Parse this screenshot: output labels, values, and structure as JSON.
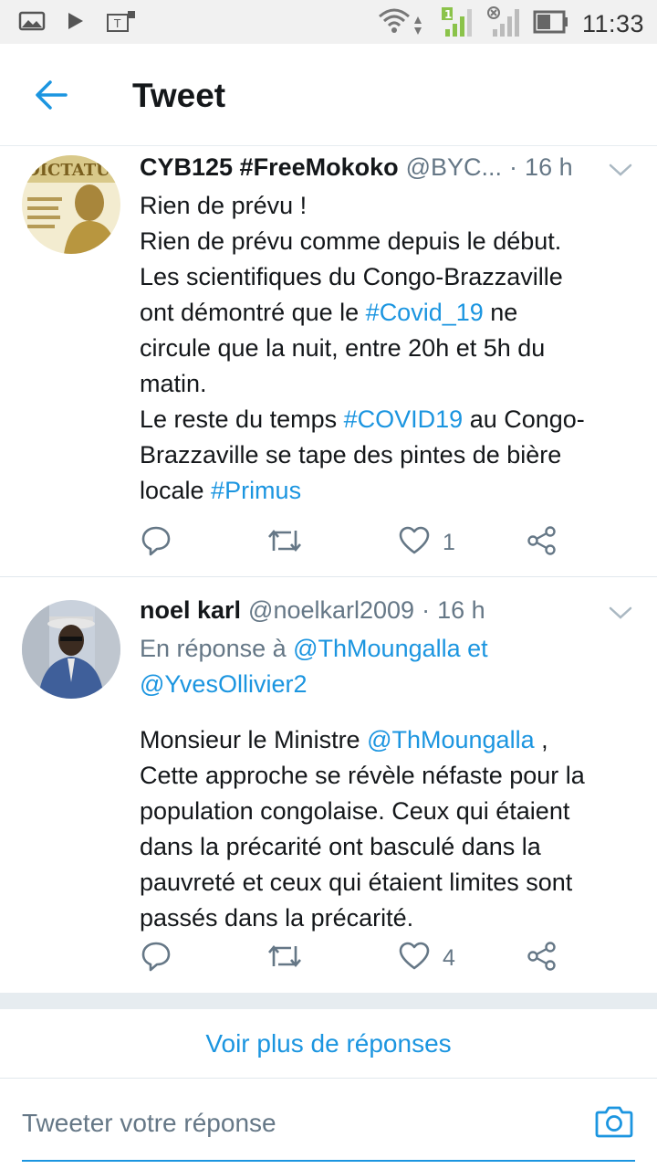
{
  "status_bar": {
    "time": "11:33",
    "icons": [
      "gallery-icon",
      "play-icon",
      "sim-t-icon",
      "wifi-icon",
      "signal-1-icon",
      "signal-x-icon",
      "battery-icon"
    ]
  },
  "header": {
    "title": "Tweet",
    "back_icon": "arrow-left-icon"
  },
  "tweets": [
    {
      "name": "CYB125 #FreeMokoko",
      "handle": "@BYC...",
      "time": "16 h",
      "lines": [
        [
          {
            "t": "Rien de prévu !"
          }
        ],
        [
          {
            "t": "Rien de prévu comme depuis le début."
          }
        ],
        [
          {
            "t": "Les scientifiques du Congo-Brazzaville"
          }
        ],
        [
          {
            "t": "ont démontré que le "
          },
          {
            "t": "#Covid_19",
            "k": "hashtag"
          },
          {
            "t": " ne"
          }
        ],
        [
          {
            "t": "circule que la nuit, entre 20h et 5h du"
          }
        ],
        [
          {
            "t": "matin."
          }
        ],
        [
          {
            "t": "Le reste du temps  "
          },
          {
            "t": "#COVID19",
            "k": "hashtag"
          },
          {
            "t": " au Congo-"
          }
        ],
        [
          {
            "t": "Brazzaville se tape des pintes de bière"
          }
        ],
        [
          {
            "t": "locale "
          },
          {
            "t": "#Primus",
            "k": "hashtag"
          }
        ]
      ],
      "reply_count": "",
      "retweet_count": "",
      "like_count": "1"
    },
    {
      "name": "noel karl",
      "handle": "@noelkarl2009",
      "time": "16 h",
      "reply_to_prefix": "En réponse à ",
      "reply_to_mention_1": "@ThMoungalla",
      "reply_to_conj": " et",
      "reply_to_mention_2": "@YvesOllivier2",
      "lines": [
        [
          {
            "t": "Monsieur le Ministre "
          },
          {
            "t": "@ThMoungalla",
            "k": "mention"
          },
          {
            "t": " ,"
          }
        ],
        [
          {
            "t": "Cette approche se révèle néfaste pour la"
          }
        ],
        [
          {
            "t": "population congolaise. Ceux qui étaient"
          }
        ],
        [
          {
            "t": "dans la précarité ont basculé dans la"
          }
        ],
        [
          {
            "t": "pauvreté et ceux qui étaient limites sont"
          }
        ],
        [
          {
            "t": "passés dans la précarité."
          }
        ]
      ],
      "reply_count": "",
      "retweet_count": "",
      "like_count": "4"
    }
  ],
  "more_replies_label": "Voir plus de réponses",
  "reply_box": {
    "placeholder": "Tweeter votre réponse"
  },
  "colors": {
    "accent": "#1b95e0",
    "muted": "#657786",
    "text": "#14171a"
  }
}
